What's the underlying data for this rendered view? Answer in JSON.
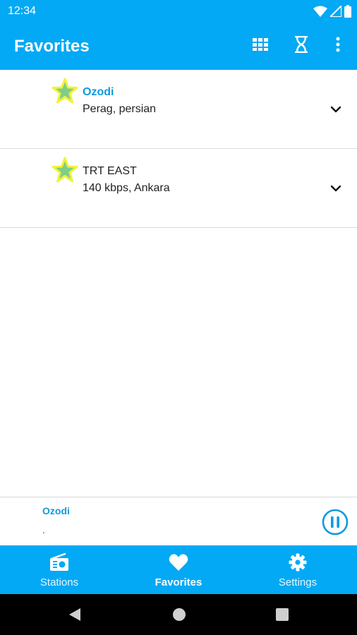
{
  "status_bar": {
    "time": "12:34",
    "icons": [
      "wifi-icon",
      "signal-icon",
      "battery-icon"
    ]
  },
  "app_bar": {
    "title": "Favorites",
    "actions": [
      "grid-view-icon",
      "sleep-timer-icon",
      "more-vert-icon"
    ]
  },
  "stations": [
    {
      "name": "Ozodi",
      "subtitle": "Perag, persian",
      "favorite": true,
      "playing": true
    },
    {
      "name": "TRT EAST",
      "subtitle": "140 kbps, Ankara",
      "favorite": true,
      "playing": false
    }
  ],
  "now_playing": {
    "title": "Ozodi",
    "subtitle": ".",
    "control": "pause-icon"
  },
  "bottom_nav": {
    "items": [
      {
        "label": "Stations",
        "icon": "radio-icon"
      },
      {
        "label": "Favorites",
        "icon": "heart-icon",
        "active": true
      },
      {
        "label": "Settings",
        "icon": "gear-icon"
      }
    ]
  },
  "colors": {
    "primary": "#03a9f4",
    "accent_text": "#0a9be0",
    "star_fill": "#7fce86",
    "star_glow": "#f2f23a"
  }
}
